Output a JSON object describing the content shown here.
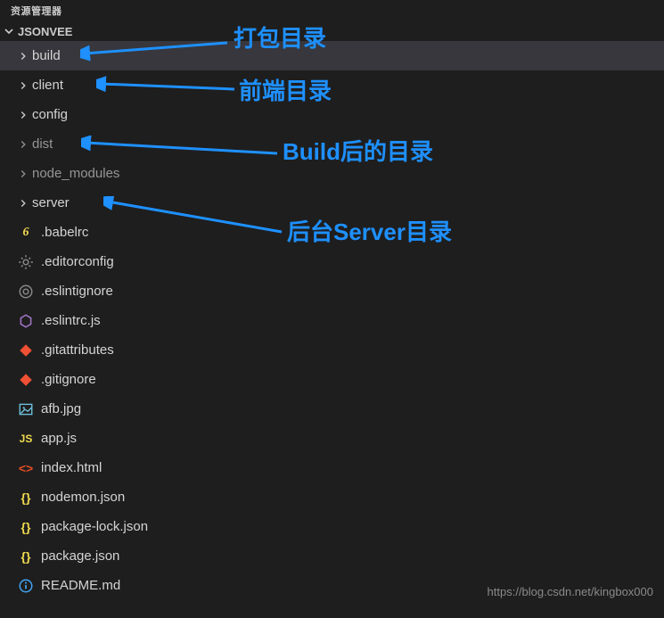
{
  "explorer_title": "资源管理器",
  "project_name": "JSONVEE",
  "tree": {
    "folders": [
      {
        "label": "build",
        "selected": true
      },
      {
        "label": "client",
        "selected": false
      },
      {
        "label": "config",
        "selected": false
      },
      {
        "label": "dist",
        "selected": false,
        "dim": true
      },
      {
        "label": "node_modules",
        "selected": false,
        "dim": true
      },
      {
        "label": "server",
        "selected": false
      }
    ],
    "files": [
      {
        "label": ".babelrc",
        "icon": "babel"
      },
      {
        "label": ".editorconfig",
        "icon": "gear"
      },
      {
        "label": ".eslintignore",
        "icon": "target"
      },
      {
        "label": ".eslintrc.js",
        "icon": "eslint"
      },
      {
        "label": ".gitattributes",
        "icon": "git"
      },
      {
        "label": ".gitignore",
        "icon": "git"
      },
      {
        "label": "afb.jpg",
        "icon": "image"
      },
      {
        "label": "app.js",
        "icon": "js"
      },
      {
        "label": "index.html",
        "icon": "html"
      },
      {
        "label": "nodemon.json",
        "icon": "json"
      },
      {
        "label": "package-lock.json",
        "icon": "json"
      },
      {
        "label": "package.json",
        "icon": "json"
      },
      {
        "label": "README.md",
        "icon": "info"
      }
    ]
  },
  "annotations": {
    "a1": "打包目录",
    "a2": "前端目录",
    "a3": "Build后的目录",
    "a4": "后台Server目录"
  },
  "watermark": "https://blog.csdn.net/kingbox000"
}
